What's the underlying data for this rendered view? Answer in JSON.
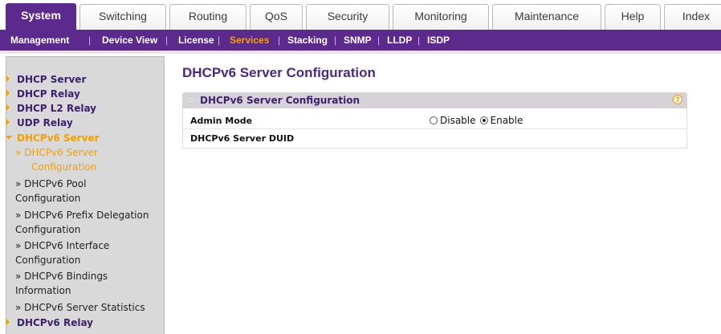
{
  "tabs": [
    {
      "label": "System",
      "active": true
    },
    {
      "label": "Switching",
      "active": false
    },
    {
      "label": "Routing",
      "active": false
    },
    {
      "label": "QoS",
      "active": false
    },
    {
      "label": "Security",
      "active": false
    },
    {
      "label": "Monitoring",
      "active": false
    },
    {
      "label": "Maintenance",
      "active": false
    },
    {
      "label": "Help",
      "active": false
    },
    {
      "label": "Index",
      "active": false
    }
  ],
  "submenu": [
    {
      "label": "Management",
      "active": false
    },
    {
      "label": "Device View",
      "active": false
    },
    {
      "label": "License",
      "active": false
    },
    {
      "label": "Services",
      "active": true
    },
    {
      "label": "Stacking",
      "active": false
    },
    {
      "label": "SNMP",
      "active": false
    },
    {
      "label": "LLDP",
      "active": false
    },
    {
      "label": "ISDP",
      "active": false
    }
  ],
  "sidebar": {
    "items": [
      {
        "label": "DHCP Server"
      },
      {
        "label": "DHCP Relay"
      },
      {
        "label": "DHCP L2 Relay"
      },
      {
        "label": "UDP Relay"
      },
      {
        "label": "DHCPv6 Server",
        "expanded": true
      },
      {
        "label": "DHCPv6 Relay"
      }
    ],
    "subitems": [
      {
        "lines": [
          "» DHCPv6 Server",
          "Configuration"
        ],
        "current": true
      },
      {
        "lines": [
          "» DHCPv6 Pool",
          "Configuration"
        ]
      },
      {
        "lines": [
          "» DHCPv6 Prefix Delegation",
          "Configuration"
        ]
      },
      {
        "lines": [
          "» DHCPv6 Interface",
          "Configuration"
        ]
      },
      {
        "lines": [
          "» DHCPv6 Bindings",
          "Information"
        ]
      },
      {
        "lines": [
          "» DHCPv6 Server Statistics"
        ]
      }
    ]
  },
  "main": {
    "page_title": "DHCPv6 Server Configuration",
    "panel_title": "DHCPv6 Server Configuration",
    "help_glyph": "?",
    "rows": {
      "admin_mode_label": "Admin Mode",
      "disable_label": "Disable",
      "enable_label": "Enable",
      "selected": "Enable",
      "duid_label": "DHCPv6 Server DUID"
    }
  },
  "colors": {
    "brand_purple": "#5c2a8c",
    "accent_orange": "#f5a100"
  }
}
